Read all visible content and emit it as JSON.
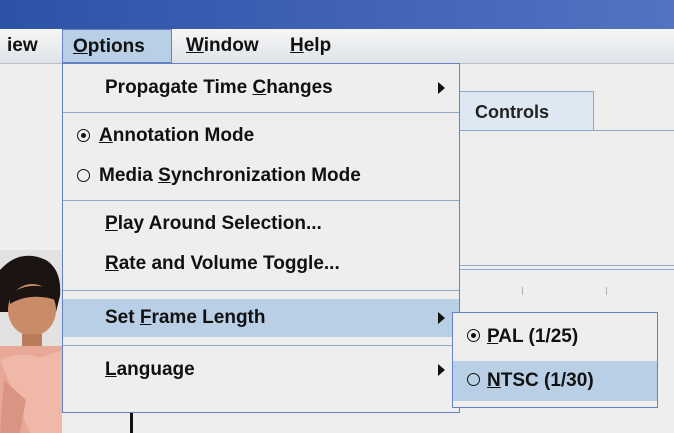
{
  "menubar": {
    "partial_view": "iew",
    "options": "Options",
    "window": "Window",
    "help": "Help"
  },
  "tab": {
    "controls": "Controls"
  },
  "options_menu": {
    "propagate": "Propagate Time Changes",
    "annotation_mode": "Annotation Mode",
    "media_sync_mode": "Media Synchronization Mode",
    "play_around": "Play Around Selection...",
    "rate_volume": "Rate and Volume Toggle...",
    "set_frame_length": "Set Frame Length",
    "language": "Language"
  },
  "frame_length_submenu": {
    "pal": "PAL (1/25)",
    "ntsc": "NTSC (1/30)"
  },
  "colors": {
    "titlebar": "#2c52a8",
    "highlight": "#b8cfe5",
    "menu_border": "#6382bf"
  }
}
